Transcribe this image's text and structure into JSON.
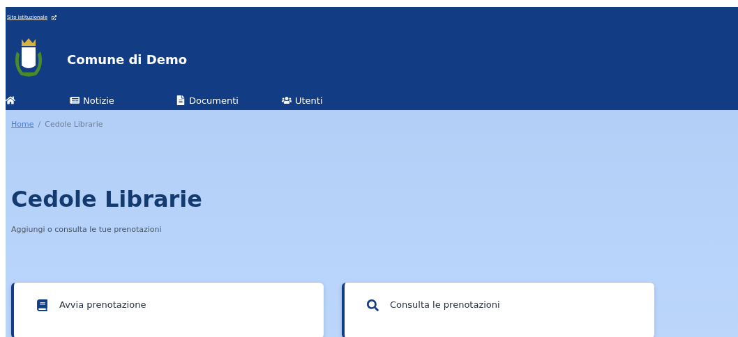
{
  "top_bar": {
    "link": "Sito istituzionale"
  },
  "brand": {
    "name": "Comune di Demo"
  },
  "nav": [
    {
      "kind": "home"
    },
    {
      "kind": "news",
      "label": "Notizie"
    },
    {
      "kind": "document",
      "label": "Documenti"
    },
    {
      "kind": "users",
      "label": "Utenti"
    }
  ],
  "breadcrumb": {
    "items": [
      "Home"
    ],
    "separator": "/",
    "current": "Cedole Librarie"
  },
  "page": {
    "title": "Cedole Librarie",
    "subtitle": "Aggiungi o consulta le tue prenotazioni"
  },
  "cards": [
    {
      "kind": "book",
      "label": "Avvia prenotazione"
    },
    {
      "kind": "search",
      "label": "Consulta le prenotazioni"
    }
  ]
}
